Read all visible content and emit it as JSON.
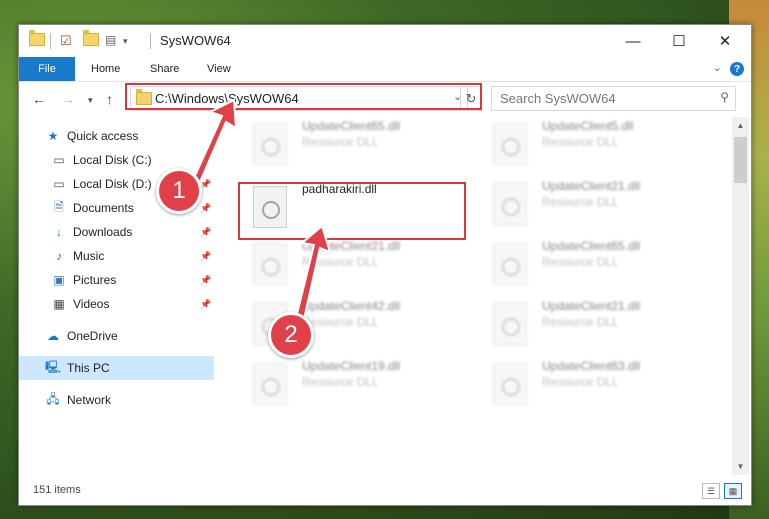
{
  "window": {
    "title": "SysWOW64",
    "controls": {
      "minimize": "—",
      "maximize": "☐",
      "close": "✕"
    }
  },
  "ribbon": {
    "tabs": [
      "File",
      "Home",
      "Share",
      "View"
    ],
    "help": "?"
  },
  "navigation": {
    "address": "C:\\Windows\\SysWOW64",
    "search_placeholder": "Search SysWOW64"
  },
  "sidebar": {
    "items": [
      {
        "label": "Quick access",
        "icon": "star-icon",
        "pinned": false
      },
      {
        "label": "Local Disk (C:)",
        "icon": "drive-icon",
        "pinned": true
      },
      {
        "label": "Local Disk (D:)",
        "icon": "drive-icon",
        "pinned": true
      },
      {
        "label": "Documents",
        "icon": "documents-icon",
        "pinned": true
      },
      {
        "label": "Downloads",
        "icon": "download-icon",
        "pinned": true
      },
      {
        "label": "Music",
        "icon": "music-icon",
        "pinned": true
      },
      {
        "label": "Pictures",
        "icon": "pictures-icon",
        "pinned": true
      },
      {
        "label": "Videos",
        "icon": "videos-icon",
        "pinned": true
      },
      {
        "label": "OneDrive",
        "icon": "cloud-icon",
        "pinned": false
      },
      {
        "label": "This PC",
        "icon": "computer-icon",
        "pinned": false,
        "selected": true
      },
      {
        "label": "Network",
        "icon": "network-icon",
        "pinned": false
      }
    ]
  },
  "files": [
    {
      "name": "UpdateClient65.dll",
      "type": "Resource DLL",
      "blurred": true
    },
    {
      "name": "UpdateClient5.dll",
      "type": "Resource DLL",
      "blurred": true
    },
    {
      "name": "padharakiri.dll",
      "type": "",
      "blurred": false,
      "highlighted": true
    },
    {
      "name": "UpdateClient21.dll",
      "type": "Resource DLL",
      "blurred": true
    },
    {
      "name": "UpdateClient21.dll",
      "type": "Resource DLL",
      "blurred": true
    },
    {
      "name": "UpdateClient65.dll",
      "type": "Resource DLL",
      "blurred": true
    },
    {
      "name": "UpdateClient42.dll",
      "type": "Resource DLL",
      "blurred": true
    },
    {
      "name": "UpdateClient21.dll",
      "type": "Resource DLL",
      "blurred": true
    },
    {
      "name": "UpdateClient19.dll",
      "type": "Resource DLL",
      "blurred": true
    },
    {
      "name": "UpdateClient63.dll",
      "type": "Resource DLL",
      "blurred": true
    }
  ],
  "status": {
    "item_count": "151 items"
  },
  "annotations": {
    "step1": "1",
    "step2": "2",
    "color": "#d9363e"
  }
}
